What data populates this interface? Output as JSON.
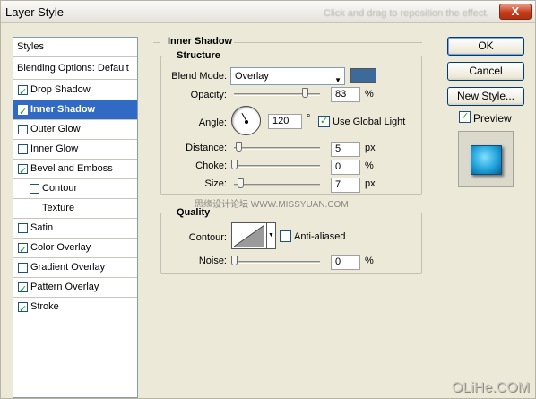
{
  "window": {
    "title": "Layer Style",
    "blurred_hint": "Click and drag to reposition the effect.",
    "close_label": "X"
  },
  "styles_list": {
    "header": "Styles",
    "blending": "Blending Options: Default",
    "items": [
      {
        "label": "Drop Shadow",
        "checked": true,
        "indent": false
      },
      {
        "label": "Inner Shadow",
        "checked": true,
        "indent": false,
        "selected": true
      },
      {
        "label": "Outer Glow",
        "checked": false,
        "indent": false
      },
      {
        "label": "Inner Glow",
        "checked": false,
        "indent": false
      },
      {
        "label": "Bevel and Emboss",
        "checked": true,
        "indent": false
      },
      {
        "label": "Contour",
        "checked": false,
        "indent": true
      },
      {
        "label": "Texture",
        "checked": false,
        "indent": true
      },
      {
        "label": "Satin",
        "checked": false,
        "indent": false
      },
      {
        "label": "Color Overlay",
        "checked": true,
        "indent": false
      },
      {
        "label": "Gradient Overlay",
        "checked": false,
        "indent": false
      },
      {
        "label": "Pattern Overlay",
        "checked": true,
        "indent": false
      },
      {
        "label": "Stroke",
        "checked": true,
        "indent": false
      }
    ]
  },
  "inner_shadow": {
    "title": "Inner Shadow",
    "structure": {
      "title": "Structure",
      "blend_mode_label": "Blend Mode:",
      "blend_mode_value": "Overlay",
      "swatch_color": "#3c6a9a",
      "opacity_label": "Opacity:",
      "opacity_value": "83",
      "opacity_unit": "%",
      "opacity_fraction": 0.83,
      "angle_label": "Angle:",
      "angle_value": "120",
      "angle_unit": "°",
      "use_global_light_label": "Use Global Light",
      "use_global_light": true,
      "distance_label": "Distance:",
      "distance_value": "5",
      "distance_unit": "px",
      "choke_label": "Choke:",
      "choke_value": "0",
      "choke_unit": "%",
      "size_label": "Size:",
      "size_value": "7",
      "size_unit": "px"
    },
    "quality": {
      "title": "Quality",
      "contour_label": "Contour:",
      "anti_aliased_label": "Anti-aliased",
      "anti_aliased": false,
      "noise_label": "Noise:",
      "noise_value": "0",
      "noise_unit": "%"
    }
  },
  "buttons": {
    "ok": "OK",
    "cancel": "Cancel",
    "new_style": "New Style...",
    "preview_label": "Preview",
    "preview_checked": true
  },
  "watermark": "思缘设计论坛 WWW.MISSYUAN.COM",
  "corner_mark": "OLiHe.COM"
}
